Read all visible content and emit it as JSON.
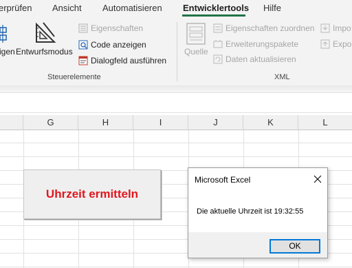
{
  "ribbon_tabs": [
    "erprüfen",
    "Ansicht",
    "Automatisieren",
    "Entwicklertools",
    "Hilfe"
  ],
  "active_tab": "Entwicklertools",
  "steuerelemente": {
    "partial_button_label": "igen",
    "design_mode_label": "Entwurfsmodus",
    "properties_label": "Eigenschaften",
    "view_code_label": "Code anzeigen",
    "run_dialog_label": "Dialogfeld ausführen",
    "group_label": "Steuerelemente"
  },
  "xml": {
    "source_label": "Quelle",
    "map_properties_label": "Eigenschaften zuordnen",
    "expansion_packs_label": "Erweiterungspakete",
    "refresh_data_label": "Daten aktualisieren",
    "import_label": "Impo",
    "export_label": "Expo",
    "group_label": "XML"
  },
  "columns": [
    "G",
    "H",
    "I",
    "J",
    "K",
    "L"
  ],
  "form_button": {
    "label": "Uhrzeit ermitteln",
    "label_color": "#e0161e"
  },
  "dialog": {
    "title": "Microsoft Excel",
    "message": "Die aktuelle Uhrzeit ist 19:32:55",
    "ok_label": "OK"
  },
  "accent_color": "#217346"
}
